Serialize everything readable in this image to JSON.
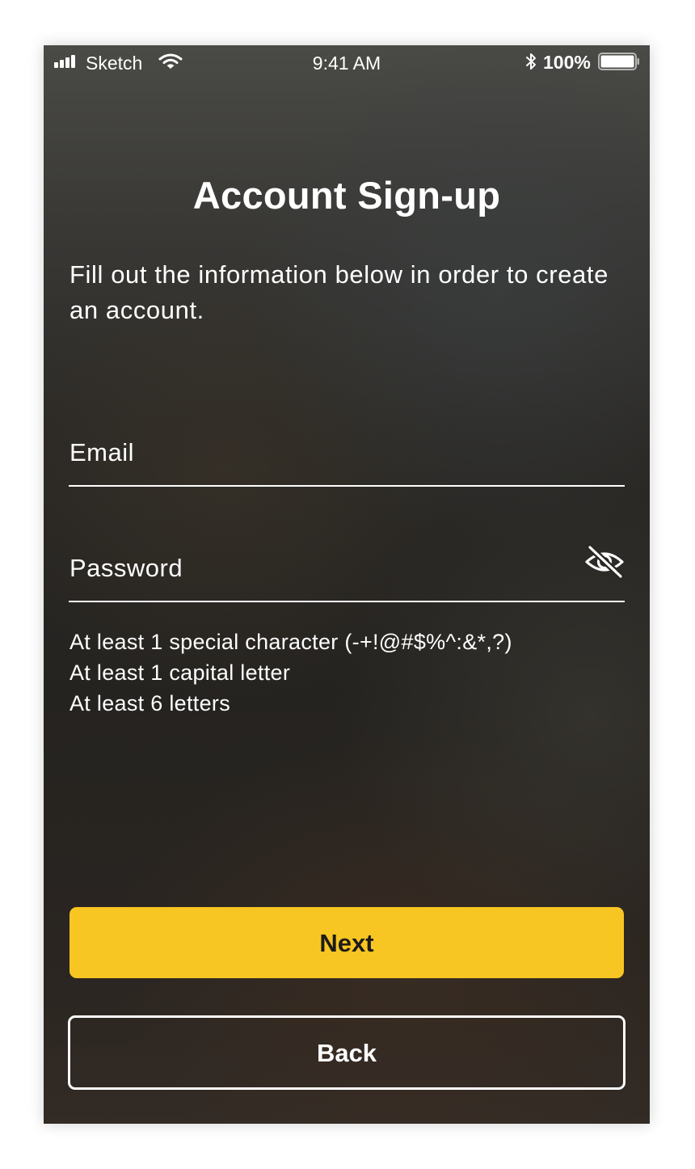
{
  "status_bar": {
    "carrier": "Sketch",
    "time": "9:41 AM",
    "battery_percent": "100%",
    "signal_icon": "signal-bars-icon",
    "wifi_icon": "wifi-icon",
    "bluetooth_icon": "bluetooth-icon",
    "battery_icon": "battery-icon",
    "battery_level": 1.0
  },
  "screen": {
    "title": "Account Sign-up",
    "intro": "Fill out the information below in order to create an account."
  },
  "form": {
    "email": {
      "placeholder": "Email",
      "value": ""
    },
    "password": {
      "placeholder": "Password",
      "value": "",
      "visibility_icon": "eye-slash-icon"
    },
    "password_rules": [
      "At least 1 special character (-+!@#$%^:&*,?)",
      "At least 1 capital letter",
      "At least 6 letters"
    ]
  },
  "actions": {
    "next_label": "Next",
    "back_label": "Back"
  },
  "colors": {
    "accent": "#F8C622",
    "text": "#FFFFFF",
    "button_text_dark": "#1E1C1A"
  }
}
